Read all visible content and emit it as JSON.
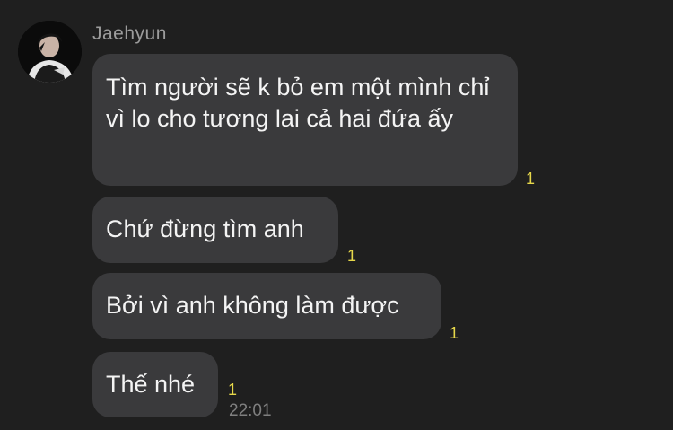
{
  "chat": {
    "sender_name": "Jaehyun",
    "avatar_icon": "profile-photo",
    "messages": [
      {
        "text": "Tìm người sẽ k bỏ em một mình chỉ vì lo cho tương lai cả hai đứa ấy",
        "unread_count": "1"
      },
      {
        "text": "Chứ đừng tìm anh",
        "unread_count": "1"
      },
      {
        "text": "Bởi vì anh không làm được",
        "unread_count": "1"
      },
      {
        "text": "Thế nhé",
        "unread_count": "1"
      }
    ],
    "last_message_time": "22:01"
  },
  "colors": {
    "background": "#1f1f1f",
    "bubble": "#3a3a3c",
    "message_text": "#f4f4f4",
    "unread_badge": "#e6d74a",
    "meta_text": "#9c9c9c"
  }
}
